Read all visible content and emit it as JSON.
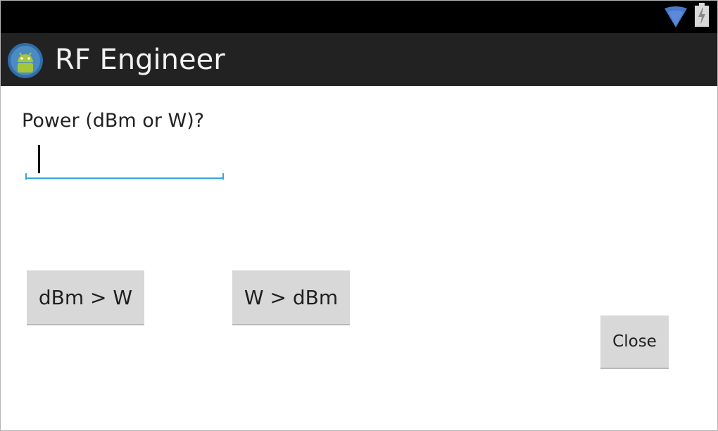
{
  "status_bar": {
    "wifi_icon": "wifi-icon",
    "battery_icon": "battery-charging-icon"
  },
  "action_bar": {
    "app_icon": "android-app-icon",
    "title": "RF Engineer"
  },
  "form": {
    "prompt_label": "Power (dBm or W)?",
    "power_input_value": "",
    "power_input_placeholder": ""
  },
  "buttons": {
    "dbm_to_w_label": "dBm > W",
    "w_to_dbm_label": "W > dBm",
    "close_label": "Close"
  },
  "colors": {
    "status_bar": "#000000",
    "action_bar": "#222222",
    "input_underline": "#33a8d6",
    "button_bg": "#d8d8d8",
    "wifi": "#4a78c8"
  }
}
